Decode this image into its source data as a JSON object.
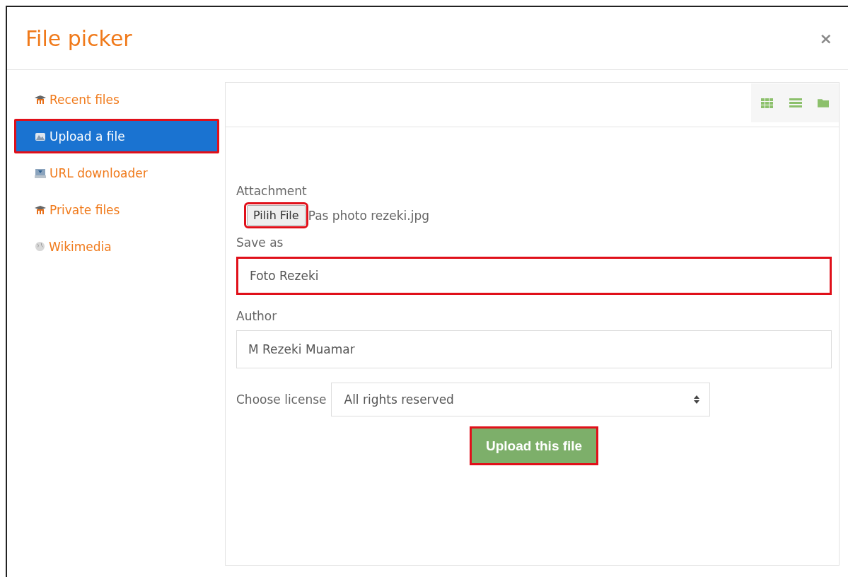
{
  "window": {
    "title": "File picker",
    "close": "×"
  },
  "sidebar": {
    "items": [
      {
        "label": "Recent files",
        "kind": "moodle",
        "selected": false,
        "highlighted": false
      },
      {
        "label": "Upload a file",
        "kind": "upload",
        "selected": true,
        "highlighted": true
      },
      {
        "label": "URL downloader",
        "kind": "download",
        "selected": false,
        "highlighted": false
      },
      {
        "label": "Private files",
        "kind": "moodle",
        "selected": false,
        "highlighted": false
      },
      {
        "label": "Wikimedia",
        "kind": "globe",
        "selected": false,
        "highlighted": false
      }
    ]
  },
  "toolbar": {
    "views": [
      {
        "kind": "grid"
      },
      {
        "kind": "list"
      },
      {
        "kind": "folder"
      }
    ]
  },
  "form": {
    "attachment": {
      "label": "Attachment",
      "button": "Pilih File",
      "button_highlighted": true,
      "file_name": "Pas photo rezeki.jpg"
    },
    "save_as": {
      "label": "Save as",
      "value": "Foto Rezeki",
      "highlighted": true
    },
    "author": {
      "label": "Author",
      "value": "M Rezeki Muamar",
      "highlighted": false
    },
    "license": {
      "label": "Choose license",
      "value": "All rights reserved"
    },
    "submit": {
      "label": "Upload this file",
      "highlighted": true
    }
  }
}
